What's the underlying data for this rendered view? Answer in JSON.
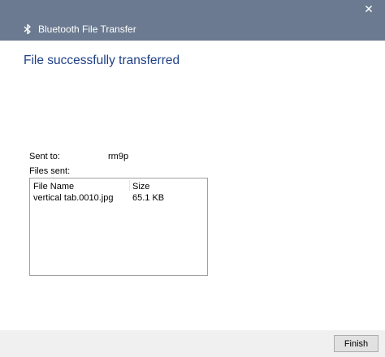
{
  "window": {
    "title": "Bluetooth File Transfer",
    "close_glyph": "✕",
    "title_icon": "bluetooth-icon"
  },
  "main": {
    "headline": "File successfully transferred",
    "sent_to_label": "Sent to:",
    "sent_to_value": "rm9p",
    "files_sent_label": "Files sent:"
  },
  "files_table": {
    "columns": [
      "File Name",
      "Size"
    ],
    "rows": [
      {
        "name": "vertical tab.0010.jpg",
        "size": "65.1 KB"
      }
    ]
  },
  "footer": {
    "finish_label": "Finish"
  },
  "colors": {
    "titlebar": "#6b7a90",
    "headline": "#1e3f85"
  }
}
